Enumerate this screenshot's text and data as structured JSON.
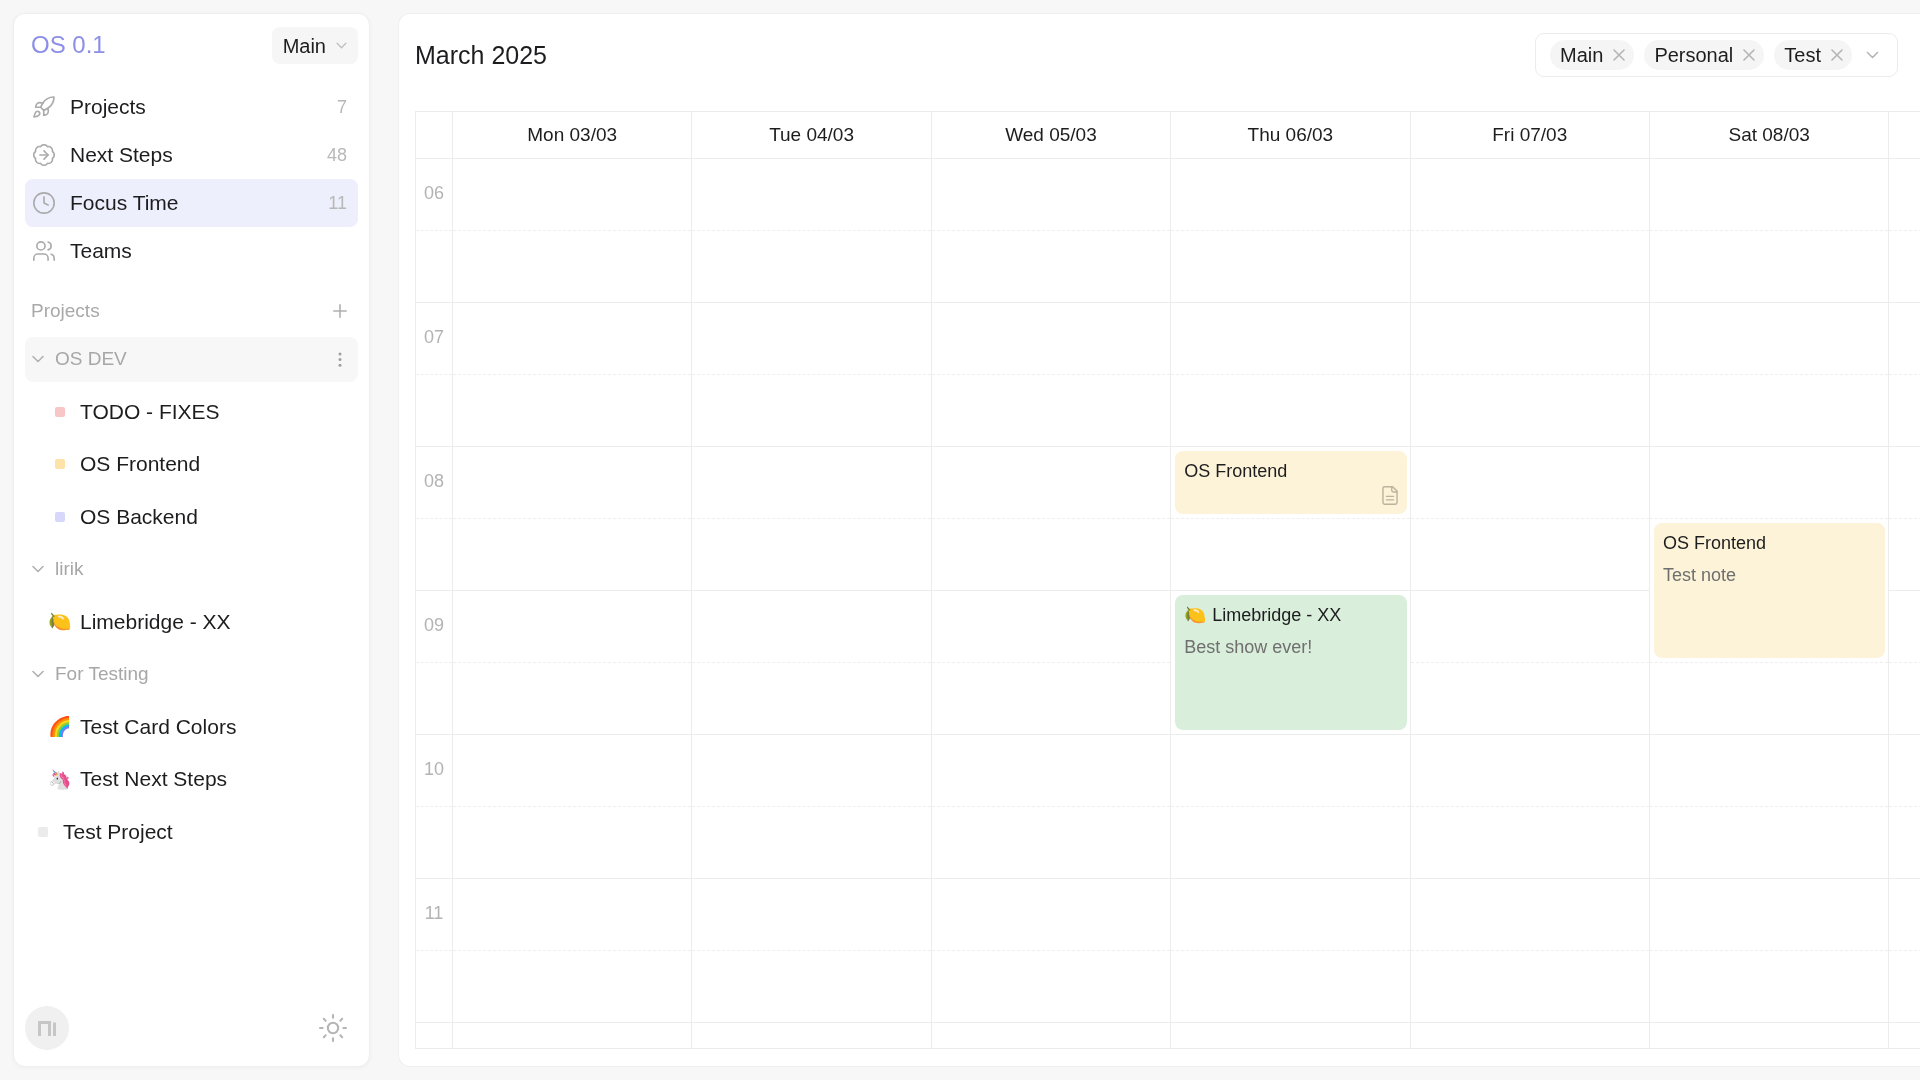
{
  "sidebar": {
    "logo": "OS 0.1",
    "workspace": "Main",
    "nav": [
      {
        "label": "Projects",
        "count": "7",
        "selected": false
      },
      {
        "label": "Next Steps",
        "count": "48",
        "selected": false
      },
      {
        "label": "Focus Time",
        "count": "11",
        "selected": true
      },
      {
        "label": "Teams",
        "selected": false
      }
    ],
    "projects_section": {
      "title": "Projects",
      "tree": [
        {
          "kind": "group",
          "label": "OS DEV",
          "expanded": true,
          "hovered": true,
          "children": [
            {
              "kind": "project",
              "label": "TODO - FIXES",
              "color": "#f8c6c6"
            },
            {
              "kind": "project",
              "label": "OS Frontend",
              "color": "#fde3a7"
            },
            {
              "kind": "project",
              "label": "OS Backend",
              "color": "#d7d6fb"
            }
          ]
        },
        {
          "kind": "group",
          "label": "lirik",
          "expanded": true,
          "hovered": false,
          "children": [
            {
              "kind": "project",
              "label": "Limebridge - XX",
              "emoji": "🍋"
            }
          ]
        },
        {
          "kind": "group",
          "label": "For Testing",
          "expanded": true,
          "hovered": false,
          "children": [
            {
              "kind": "project",
              "label": "Test Card Colors",
              "emoji": "🌈"
            },
            {
              "kind": "project",
              "label": "Test Next Steps",
              "emoji": "🦄"
            }
          ]
        },
        {
          "kind": "project",
          "label": "Test Project",
          "color": "#ebebeb"
        }
      ]
    }
  },
  "calendar": {
    "title": "March 2025",
    "filters": [
      "Main",
      "Personal",
      "Test"
    ],
    "hours": [
      "06",
      "07",
      "08",
      "09",
      "10",
      "11"
    ],
    "days": [
      {
        "label": "Mon 03/03",
        "slots": [
          {
            "kind": "free"
          },
          {
            "kind": "free"
          },
          {
            "kind": "free"
          },
          {
            "kind": "free"
          },
          {
            "kind": "free"
          },
          {
            "kind": "free"
          },
          {
            "kind": "free"
          },
          {
            "kind": "free"
          },
          {
            "kind": "free"
          },
          {
            "kind": "free"
          },
          {
            "kind": "free"
          },
          {
            "kind": "free"
          }
        ]
      },
      {
        "label": "Tue 04/03",
        "slots": [
          {
            "kind": "free"
          },
          {
            "kind": "free"
          },
          {
            "kind": "free"
          },
          {
            "kind": "free"
          },
          {
            "kind": "free"
          },
          {
            "kind": "free"
          },
          {
            "kind": "free"
          },
          {
            "kind": "free"
          },
          {
            "kind": "free"
          },
          {
            "kind": "free"
          },
          {
            "kind": "free"
          },
          {
            "kind": "free"
          }
        ]
      },
      {
        "label": "Wed 05/03",
        "slots": [
          {
            "kind": "free"
          },
          {
            "kind": "free"
          },
          {
            "kind": "free"
          },
          {
            "kind": "free"
          },
          {
            "kind": "free"
          },
          {
            "kind": "free"
          },
          {
            "kind": "free"
          },
          {
            "kind": "free"
          },
          {
            "kind": "free"
          },
          {
            "kind": "free"
          },
          {
            "kind": "free"
          },
          {
            "kind": "free"
          }
        ]
      },
      {
        "label": "Thu 06/03",
        "slots": [
          {
            "kind": "free"
          },
          {
            "kind": "free"
          },
          {
            "kind": "free"
          },
          {
            "kind": "free"
          },
          {
            "kind": "short",
            "title": "OS Frontend",
            "color": "#fdf3d8",
            "has_document": true
          },
          {
            "kind": "free"
          },
          {
            "kind": "long",
            "emoji": "🍋",
            "title": "Limebridge - XX",
            "note": "Best show ever!",
            "color": "#d9eedb",
            "has_document": false
          },
          {
            "kind": "free"
          },
          {
            "kind": "free"
          },
          {
            "kind": "free"
          },
          {
            "kind": "free"
          }
        ]
      },
      {
        "label": "Fri 07/03",
        "slots": [
          {
            "kind": "free"
          },
          {
            "kind": "free"
          },
          {
            "kind": "free"
          },
          {
            "kind": "free"
          },
          {
            "kind": "free"
          },
          {
            "kind": "free"
          },
          {
            "kind": "free"
          },
          {
            "kind": "free"
          },
          {
            "kind": "free"
          },
          {
            "kind": "free"
          },
          {
            "kind": "free"
          },
          {
            "kind": "free"
          }
        ]
      },
      {
        "label": "Sat 08/03",
        "slots": [
          {
            "kind": "free"
          },
          {
            "kind": "free"
          },
          {
            "kind": "free"
          },
          {
            "kind": "free"
          },
          {
            "kind": "free"
          },
          {
            "kind": "long",
            "title": "OS Frontend",
            "note": "Test note",
            "color": "#fdf3d8",
            "has_document": false
          },
          {
            "kind": "free"
          },
          {
            "kind": "free"
          },
          {
            "kind": "free"
          },
          {
            "kind": "free"
          },
          {
            "kind": "free"
          }
        ]
      }
    ]
  }
}
